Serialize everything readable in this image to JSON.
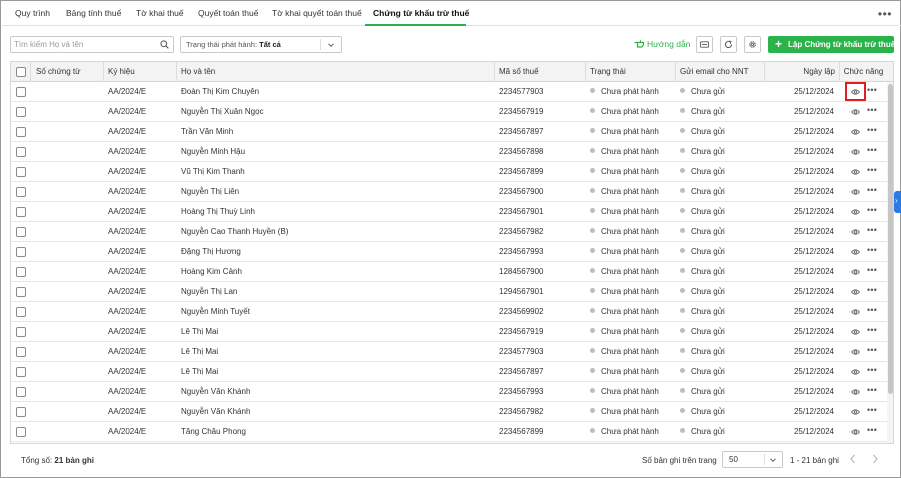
{
  "tabs": [
    {
      "label": "Quy trình"
    },
    {
      "label": "Bảng tính thuế"
    },
    {
      "label": "Tờ khai thuế"
    },
    {
      "label": "Quyết toán thuế"
    },
    {
      "label": "Tờ khai quyết toán thuế"
    },
    {
      "label": "Chứng từ khấu trừ thuế"
    }
  ],
  "active_tab": "Chứng từ khấu trừ thuế",
  "more_label": "•••",
  "toolbar": {
    "search_placeholder": "Tìm kiếm Họ và tên",
    "status_filter_label": "Trạng thái phát hành:",
    "status_filter_value": "Tất cả",
    "guide_label": "Hướng dẫn",
    "create_label": "Lập Chứng từ khấu trừ thuế"
  },
  "columns": {
    "doc_no": "Số chứng từ",
    "symbol": "Ký hiệu",
    "name": "Họ và tên",
    "tax_code": "Mã số thuế",
    "status": "Trạng thái",
    "email": "Gửi email cho NNT",
    "date": "Ngày lập",
    "actions": "Chức năng"
  },
  "rows": [
    {
      "doc_no": "",
      "symbol": "AA/2024/E",
      "name": "Đoàn Thị Kim Chuyên",
      "tax_code": "2234577903",
      "status": "Chưa phát hành",
      "email": "Chưa gửi",
      "date": "25/12/2024"
    },
    {
      "doc_no": "",
      "symbol": "AA/2024/E",
      "name": "Nguyễn Thị Xuân Ngọc",
      "tax_code": "2234567919",
      "status": "Chưa phát hành",
      "email": "Chưa gửi",
      "date": "25/12/2024"
    },
    {
      "doc_no": "",
      "symbol": "AA/2024/E",
      "name": "Trần Văn Minh",
      "tax_code": "2234567897",
      "status": "Chưa phát hành",
      "email": "Chưa gửi",
      "date": "25/12/2024"
    },
    {
      "doc_no": "",
      "symbol": "AA/2024/E",
      "name": "Nguyễn Minh Hậu",
      "tax_code": "2234567898",
      "status": "Chưa phát hành",
      "email": "Chưa gửi",
      "date": "25/12/2024"
    },
    {
      "doc_no": "",
      "symbol": "AA/2024/E",
      "name": "Vũ Thị Kim Thanh",
      "tax_code": "2234567899",
      "status": "Chưa phát hành",
      "email": "Chưa gửi",
      "date": "25/12/2024"
    },
    {
      "doc_no": "",
      "symbol": "AA/2024/E",
      "name": "Nguyễn Thị Liên",
      "tax_code": "2234567900",
      "status": "Chưa phát hành",
      "email": "Chưa gửi",
      "date": "25/12/2024"
    },
    {
      "doc_no": "",
      "symbol": "AA/2024/E",
      "name": "Hoàng Thị Thuỳ Linh",
      "tax_code": "2234567901",
      "status": "Chưa phát hành",
      "email": "Chưa gửi",
      "date": "25/12/2024"
    },
    {
      "doc_no": "",
      "symbol": "AA/2024/E",
      "name": "Nguyễn Cao Thanh Huyền (B)",
      "tax_code": "2234567982",
      "status": "Chưa phát hành",
      "email": "Chưa gửi",
      "date": "25/12/2024"
    },
    {
      "doc_no": "",
      "symbol": "AA/2024/E",
      "name": "Đặng Thị Hương",
      "tax_code": "2234567993",
      "status": "Chưa phát hành",
      "email": "Chưa gửi",
      "date": "25/12/2024"
    },
    {
      "doc_no": "",
      "symbol": "AA/2024/E",
      "name": "Hoàng Kim Cảnh",
      "tax_code": "1284567900",
      "status": "Chưa phát hành",
      "email": "Chưa gửi",
      "date": "25/12/2024"
    },
    {
      "doc_no": "",
      "symbol": "AA/2024/E",
      "name": "Nguyễn Thị Lan",
      "tax_code": "1294567901",
      "status": "Chưa phát hành",
      "email": "Chưa gửi",
      "date": "25/12/2024"
    },
    {
      "doc_no": "",
      "symbol": "AA/2024/E",
      "name": "Nguyễn Minh Tuyết",
      "tax_code": "2234569902",
      "status": "Chưa phát hành",
      "email": "Chưa gửi",
      "date": "25/12/2024"
    },
    {
      "doc_no": "",
      "symbol": "AA/2024/E",
      "name": "Lê Thị Mai",
      "tax_code": "2234567919",
      "status": "Chưa phát hành",
      "email": "Chưa gửi",
      "date": "25/12/2024"
    },
    {
      "doc_no": "",
      "symbol": "AA/2024/E",
      "name": "Lê Thị Mai",
      "tax_code": "2234577903",
      "status": "Chưa phát hành",
      "email": "Chưa gửi",
      "date": "25/12/2024"
    },
    {
      "doc_no": "",
      "symbol": "AA/2024/E",
      "name": "Lê Thị Mai",
      "tax_code": "2234567897",
      "status": "Chưa phát hành",
      "email": "Chưa gửi",
      "date": "25/12/2024"
    },
    {
      "doc_no": "",
      "symbol": "AA/2024/E",
      "name": "Nguyễn Văn Khánh",
      "tax_code": "2234567993",
      "status": "Chưa phát hành",
      "email": "Chưa gửi",
      "date": "25/12/2024"
    },
    {
      "doc_no": "",
      "symbol": "AA/2024/E",
      "name": "Nguyễn Văn Khánh",
      "tax_code": "2234567982",
      "status": "Chưa phát hành",
      "email": "Chưa gửi",
      "date": "25/12/2024"
    },
    {
      "doc_no": "",
      "symbol": "AA/2024/E",
      "name": "Tăng Châu Phong",
      "tax_code": "2234567899",
      "status": "Chưa phát hành",
      "email": "Chưa gửi",
      "date": "25/12/2024"
    }
  ],
  "row_more_label": "•••",
  "footer": {
    "total_label": "Tổng số:",
    "total_value": "21 bản ghi",
    "per_page_label": "Số bản ghi trên trang",
    "per_page_value": "50",
    "range": "1 - 21 bản ghi"
  },
  "colors": {
    "accent": "#2bb34b",
    "highlight": "#e02020",
    "side_handle": "#2c7be5"
  },
  "icons": [
    "search-icon",
    "chevron-down-icon",
    "hand-pointer-icon",
    "card-icon",
    "refresh-icon",
    "gear-icon",
    "plus-icon",
    "eye-icon",
    "more-icon",
    "chevron-left-icon",
    "chevron-right-icon"
  ]
}
